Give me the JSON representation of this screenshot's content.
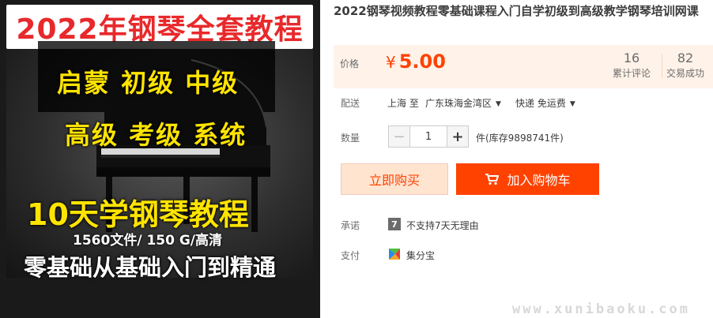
{
  "product_image": {
    "top_banner": "2022年钢琴全套教程",
    "levels_line1": "启蒙  初级  中级",
    "levels_line2": "高级  考级  系统",
    "headline": "10天学钢琴教程",
    "subline": "1560文件/ 150 G/高清",
    "bottom_line": "零基础从基础入门到精通"
  },
  "title": "2022钢琴视频教程零基础课程入门自学初级到高级教学钢琴培训网课",
  "price": {
    "label": "价格",
    "currency": "¥",
    "amount": "5.00",
    "accent_color": "#ff4200"
  },
  "stats": {
    "reviews_count": "16",
    "reviews_label": "累计评论",
    "sales_count": "82",
    "sales_label": "交易成功"
  },
  "shipping": {
    "label": "配送",
    "from": "上海 至",
    "destination": "广东珠海金湾区",
    "method": "快递 免运费"
  },
  "quantity": {
    "label": "数量",
    "minus": "−",
    "value": "1",
    "plus": "+",
    "stock": "件(库存9898741件)"
  },
  "actions": {
    "buy_now": "立即购买",
    "add_to_cart": "加入购物车"
  },
  "promise": {
    "label": "承诺",
    "badge": "7",
    "text": "不支持7天无理由"
  },
  "payment": {
    "label": "支付",
    "method": "集分宝",
    "icon": "jifenbao-icon"
  },
  "watermark": "www.xunibaoku.com"
}
